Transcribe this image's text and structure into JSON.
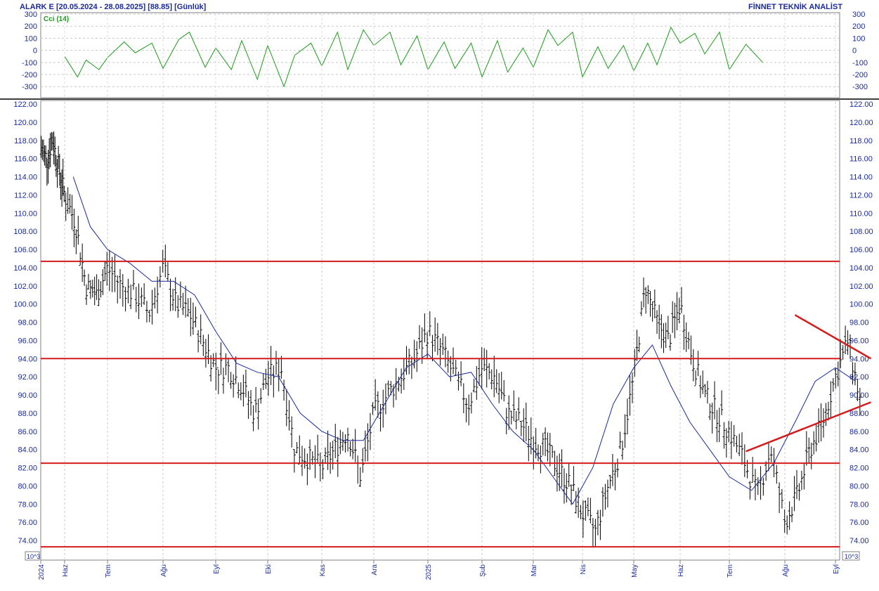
{
  "header": {
    "symbol_info": "ALARK E  [20.05.2024 - 28.08.2025]  [88.85]  [Günlük]",
    "brand": "FİNNET TEKNİK ANALİST"
  },
  "chart_data": [
    {
      "type": "line",
      "indicator": "Cci (14)",
      "y_ticks": [
        300,
        200,
        100,
        0,
        -100,
        -200,
        -300
      ],
      "ylim": [
        -380,
        300
      ],
      "grid": "horizontal dotted",
      "series": [
        {
          "name": "Cci (14)",
          "color": "#1a9c1a",
          "x_month_index": [
            1.0,
            1.3,
            1.5,
            1.8,
            2.0,
            2.3,
            2.5,
            2.8,
            3.0,
            3.3,
            3.5,
            3.8,
            4.0,
            4.3,
            4.5,
            4.8,
            5.0,
            5.3,
            5.5,
            5.8,
            6.0,
            6.3,
            6.5,
            6.8,
            7.0,
            7.3,
            7.5,
            7.8,
            8.0,
            8.3,
            8.5,
            8.8,
            9.0,
            9.3,
            9.5,
            9.8,
            10.0,
            10.3,
            10.5,
            10.8,
            11.0,
            11.3,
            11.5,
            11.8,
            12.0,
            12.3,
            12.5,
            12.8,
            13.0,
            13.3,
            13.5,
            13.8,
            14.0,
            14.3,
            14.6
          ],
          "values": [
            -50,
            -220,
            -80,
            -160,
            -60,
            70,
            -20,
            60,
            -150,
            90,
            150,
            -140,
            20,
            -160,
            80,
            -240,
            40,
            -300,
            -40,
            60,
            -130,
            150,
            -160,
            170,
            40,
            150,
            -120,
            120,
            -160,
            70,
            -150,
            60,
            -220,
            80,
            -180,
            20,
            -140,
            170,
            40,
            150,
            -220,
            30,
            -150,
            40,
            -170,
            60,
            -120,
            190,
            60,
            140,
            -30,
            150,
            -160,
            50,
            -100
          ]
        }
      ]
    },
    {
      "type": "bar",
      "style": "OHLC daily price bars with moving average",
      "ylim": [
        73,
        122
      ],
      "y_ticks": [
        122,
        120,
        118,
        116,
        114,
        112,
        110,
        108,
        106,
        104,
        102,
        100,
        98,
        96,
        94,
        92,
        90,
        88,
        86,
        84,
        82,
        80,
        78,
        76,
        74
      ],
      "y_tick_labels": [
        "122.00",
        "120.00",
        "118.00",
        "116.00",
        "114.00",
        "112.00",
        "110.00",
        "108.00",
        "106.00",
        "104.00",
        "102.00",
        "100.00",
        "98.00",
        "96.00",
        "94.00",
        "92.00",
        "90.00",
        "88.00",
        "86.00",
        "84.00",
        "82.00",
        "80.00",
        "78.00",
        "76.00",
        "74.00"
      ],
      "unit_label": "10^3",
      "x_ticks": [
        "2024",
        "Haz",
        "Tem",
        "Ağu",
        "Eyl",
        "Eki",
        "Kas",
        "Ara",
        "2025",
        "Şub",
        "Mar",
        "Nis",
        "May",
        "Haz",
        "Tem",
        "Ağu",
        "Eyl"
      ],
      "price_series": {
        "name": "ALARK E",
        "x_month_index": [
          0.0,
          0.25,
          0.5,
          0.75,
          1.0,
          1.25,
          1.5,
          1.75,
          2.0,
          2.25,
          2.5,
          2.75,
          3.0,
          3.25,
          3.5,
          3.75,
          4.0,
          4.25,
          4.5,
          4.75,
          5.0,
          5.25,
          5.5,
          5.75,
          6.0,
          6.25,
          6.5,
          6.75,
          7.0,
          7.25,
          7.5,
          7.75,
          8.0,
          8.25,
          8.5,
          8.75,
          9.0,
          9.25,
          9.5,
          9.75,
          10.0,
          10.25,
          10.5,
          10.75,
          11.0,
          11.25,
          11.5,
          11.75,
          12.0,
          12.25,
          12.5,
          12.75,
          13.0,
          13.25,
          13.5,
          13.75,
          14.0,
          14.25,
          14.5,
          14.75,
          15.0,
          15.25,
          15.5,
          15.75,
          16.0,
          16.25,
          16.5
        ],
        "close": [
          117,
          116,
          118,
          115,
          112,
          109,
          102,
          101,
          104,
          102,
          101,
          99,
          104,
          100,
          99,
          96,
          93,
          93,
          91,
          88,
          92,
          93,
          84,
          83,
          82,
          84,
          86,
          81,
          88,
          90,
          92,
          94,
          97,
          95,
          92,
          89,
          93,
          92,
          88,
          87,
          85,
          84,
          82,
          80,
          77,
          75,
          80,
          84,
          92,
          102,
          98,
          96,
          100,
          94,
          90,
          88,
          86,
          83,
          79,
          84,
          76,
          79,
          84,
          87,
          92,
          96,
          89
        ]
      },
      "moving_average": {
        "color": "#1a2a9c",
        "x_month_index": [
          1.2,
          1.6,
          2.0,
          2.4,
          2.8,
          3.2,
          3.6,
          4.0,
          4.4,
          4.8,
          5.2,
          5.6,
          6.0,
          6.4,
          6.8,
          7.2,
          7.6,
          8.0,
          8.4,
          8.8,
          9.2,
          9.6,
          10.0,
          10.4,
          10.8,
          11.2,
          11.6,
          12.0,
          12.4,
          12.8,
          13.2,
          13.6,
          14.0,
          14.4,
          14.8,
          15.2,
          15.6,
          16.0,
          16.4
        ],
        "values": [
          114,
          108.5,
          106,
          104.5,
          102.5,
          102.5,
          101,
          97,
          93.5,
          92.5,
          92,
          88,
          86,
          85,
          85,
          89,
          93,
          94.5,
          92,
          92.5,
          89,
          86,
          84,
          81,
          78,
          82,
          89,
          93,
          95.5,
          91,
          87,
          84,
          81,
          79.5,
          82.5,
          87,
          91.5,
          93,
          91.5
        ]
      },
      "horizontal_levels": [
        104.7,
        94.0,
        82.5,
        73.3
      ],
      "trendlines": [
        {
          "color": "#d41a1a",
          "from": [
            15.2,
            98.8
          ],
          "to": [
            16.7,
            94.0
          ]
        },
        {
          "color": "#d41a1a",
          "from": [
            14.3,
            83.8
          ],
          "to": [
            16.7,
            89.2
          ]
        }
      ]
    }
  ]
}
